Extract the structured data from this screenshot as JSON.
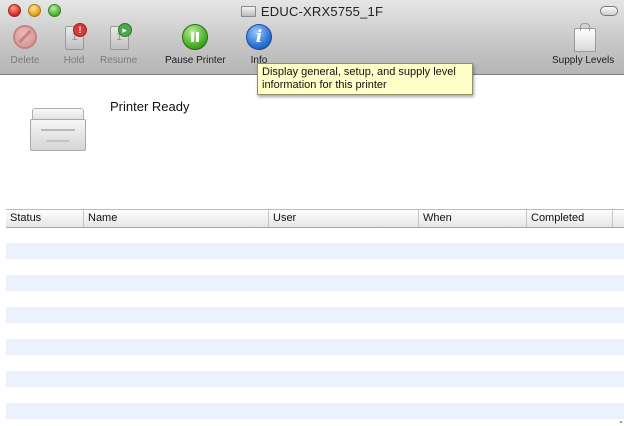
{
  "window": {
    "title": "EDUC-XRX5755_1F"
  },
  "toolbar": {
    "delete_label": "Delete",
    "hold_label": "Hold",
    "resume_label": "Resume",
    "pause_label": "Pause Printer",
    "info_label": "Info",
    "supply_label": "Supply Levels"
  },
  "tooltip": {
    "text": "Display general, setup, and supply level information for this printer"
  },
  "printer": {
    "status": "Printer Ready"
  },
  "jobs": {
    "columns": [
      "Status",
      "Name",
      "User",
      "When",
      "Completed"
    ],
    "rows": []
  }
}
